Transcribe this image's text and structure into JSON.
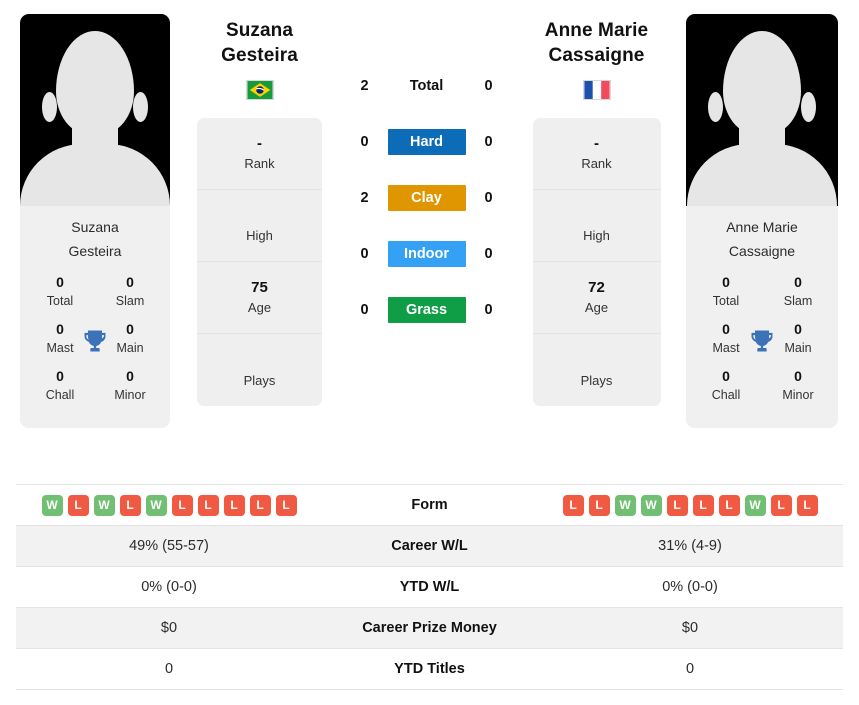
{
  "players": {
    "left": {
      "name": "Suzana Gesteira",
      "name_line1": "Suzana",
      "name_line2": "Gesteira",
      "card_name_line1": "Suzana",
      "card_name_line2": "Gesteira",
      "country": "Brazil",
      "flag_icon": "flag-brazil-icon",
      "rank": "-",
      "rank_label": "Rank",
      "high": "",
      "high_label": "High",
      "age": "75",
      "age_label": "Age",
      "plays": "",
      "plays_label": "Plays",
      "titles": {
        "total": "0",
        "total_label": "Total",
        "slam": "0",
        "slam_label": "Slam",
        "mast": "0",
        "mast_label": "Mast",
        "main": "0",
        "main_label": "Main",
        "chall": "0",
        "chall_label": "Chall",
        "minor": "0",
        "minor_label": "Minor"
      },
      "form": [
        "W",
        "L",
        "W",
        "L",
        "W",
        "L",
        "L",
        "L",
        "L",
        "L"
      ],
      "career_wl": "49% (55-57)",
      "ytd_wl": "0% (0-0)",
      "career_prize_money": "$0",
      "ytd_titles": "0"
    },
    "right": {
      "name": "Anne Marie Cassaigne",
      "name_line1": "Anne Marie",
      "name_line2": "Cassaigne",
      "card_name_line1": "Anne Marie",
      "card_name_line2": "Cassaigne",
      "country": "France",
      "flag_icon": "flag-france-icon",
      "rank": "-",
      "rank_label": "Rank",
      "high": "",
      "high_label": "High",
      "age": "72",
      "age_label": "Age",
      "plays": "",
      "plays_label": "Plays",
      "titles": {
        "total": "0",
        "total_label": "Total",
        "slam": "0",
        "slam_label": "Slam",
        "mast": "0",
        "mast_label": "Mast",
        "main": "0",
        "main_label": "Main",
        "chall": "0",
        "chall_label": "Chall",
        "minor": "0",
        "minor_label": "Minor"
      },
      "form": [
        "L",
        "L",
        "W",
        "W",
        "L",
        "L",
        "L",
        "W",
        "L",
        "L"
      ],
      "career_wl": "31% (4-9)",
      "ytd_wl": "0% (0-0)",
      "career_prize_money": "$0",
      "ytd_titles": "0"
    }
  },
  "head_to_head": {
    "rows": [
      {
        "left": "2",
        "label": "Total",
        "right": "0",
        "chip": false,
        "color": ""
      },
      {
        "left": "0",
        "label": "Hard",
        "right": "0",
        "chip": true,
        "color": "#0c6cb8"
      },
      {
        "left": "2",
        "label": "Clay",
        "right": "0",
        "chip": true,
        "color": "#e09600"
      },
      {
        "left": "0",
        "label": "Indoor",
        "right": "0",
        "chip": true,
        "color": "#35a1f5"
      },
      {
        "left": "0",
        "label": "Grass",
        "right": "0",
        "chip": true,
        "color": "#0f9d45"
      }
    ]
  },
  "stats_table": {
    "rows": [
      {
        "label": "Form",
        "left": "",
        "right": "",
        "type": "form"
      },
      {
        "label": "Career W/L",
        "left": "49% (55-57)",
        "right": "31% (4-9)",
        "type": "text"
      },
      {
        "label": "YTD W/L",
        "left": "0% (0-0)",
        "right": "0% (0-0)",
        "type": "text"
      },
      {
        "label": "Career Prize Money",
        "left": "$0",
        "right": "$0",
        "type": "text"
      },
      {
        "label": "YTD Titles",
        "left": "0",
        "right": "0",
        "type": "text"
      }
    ]
  },
  "colors": {
    "win": "#70bf73",
    "loss": "#f05a43",
    "hard": "#0c6cb8",
    "clay": "#e09600",
    "indoor": "#35a1f5",
    "grass": "#0f9d45",
    "panel_bg": "#efefef",
    "row_alt_bg": "#f2f2f2",
    "trophy": "#3b72b8"
  },
  "icons": {
    "trophy": "trophy-icon"
  }
}
